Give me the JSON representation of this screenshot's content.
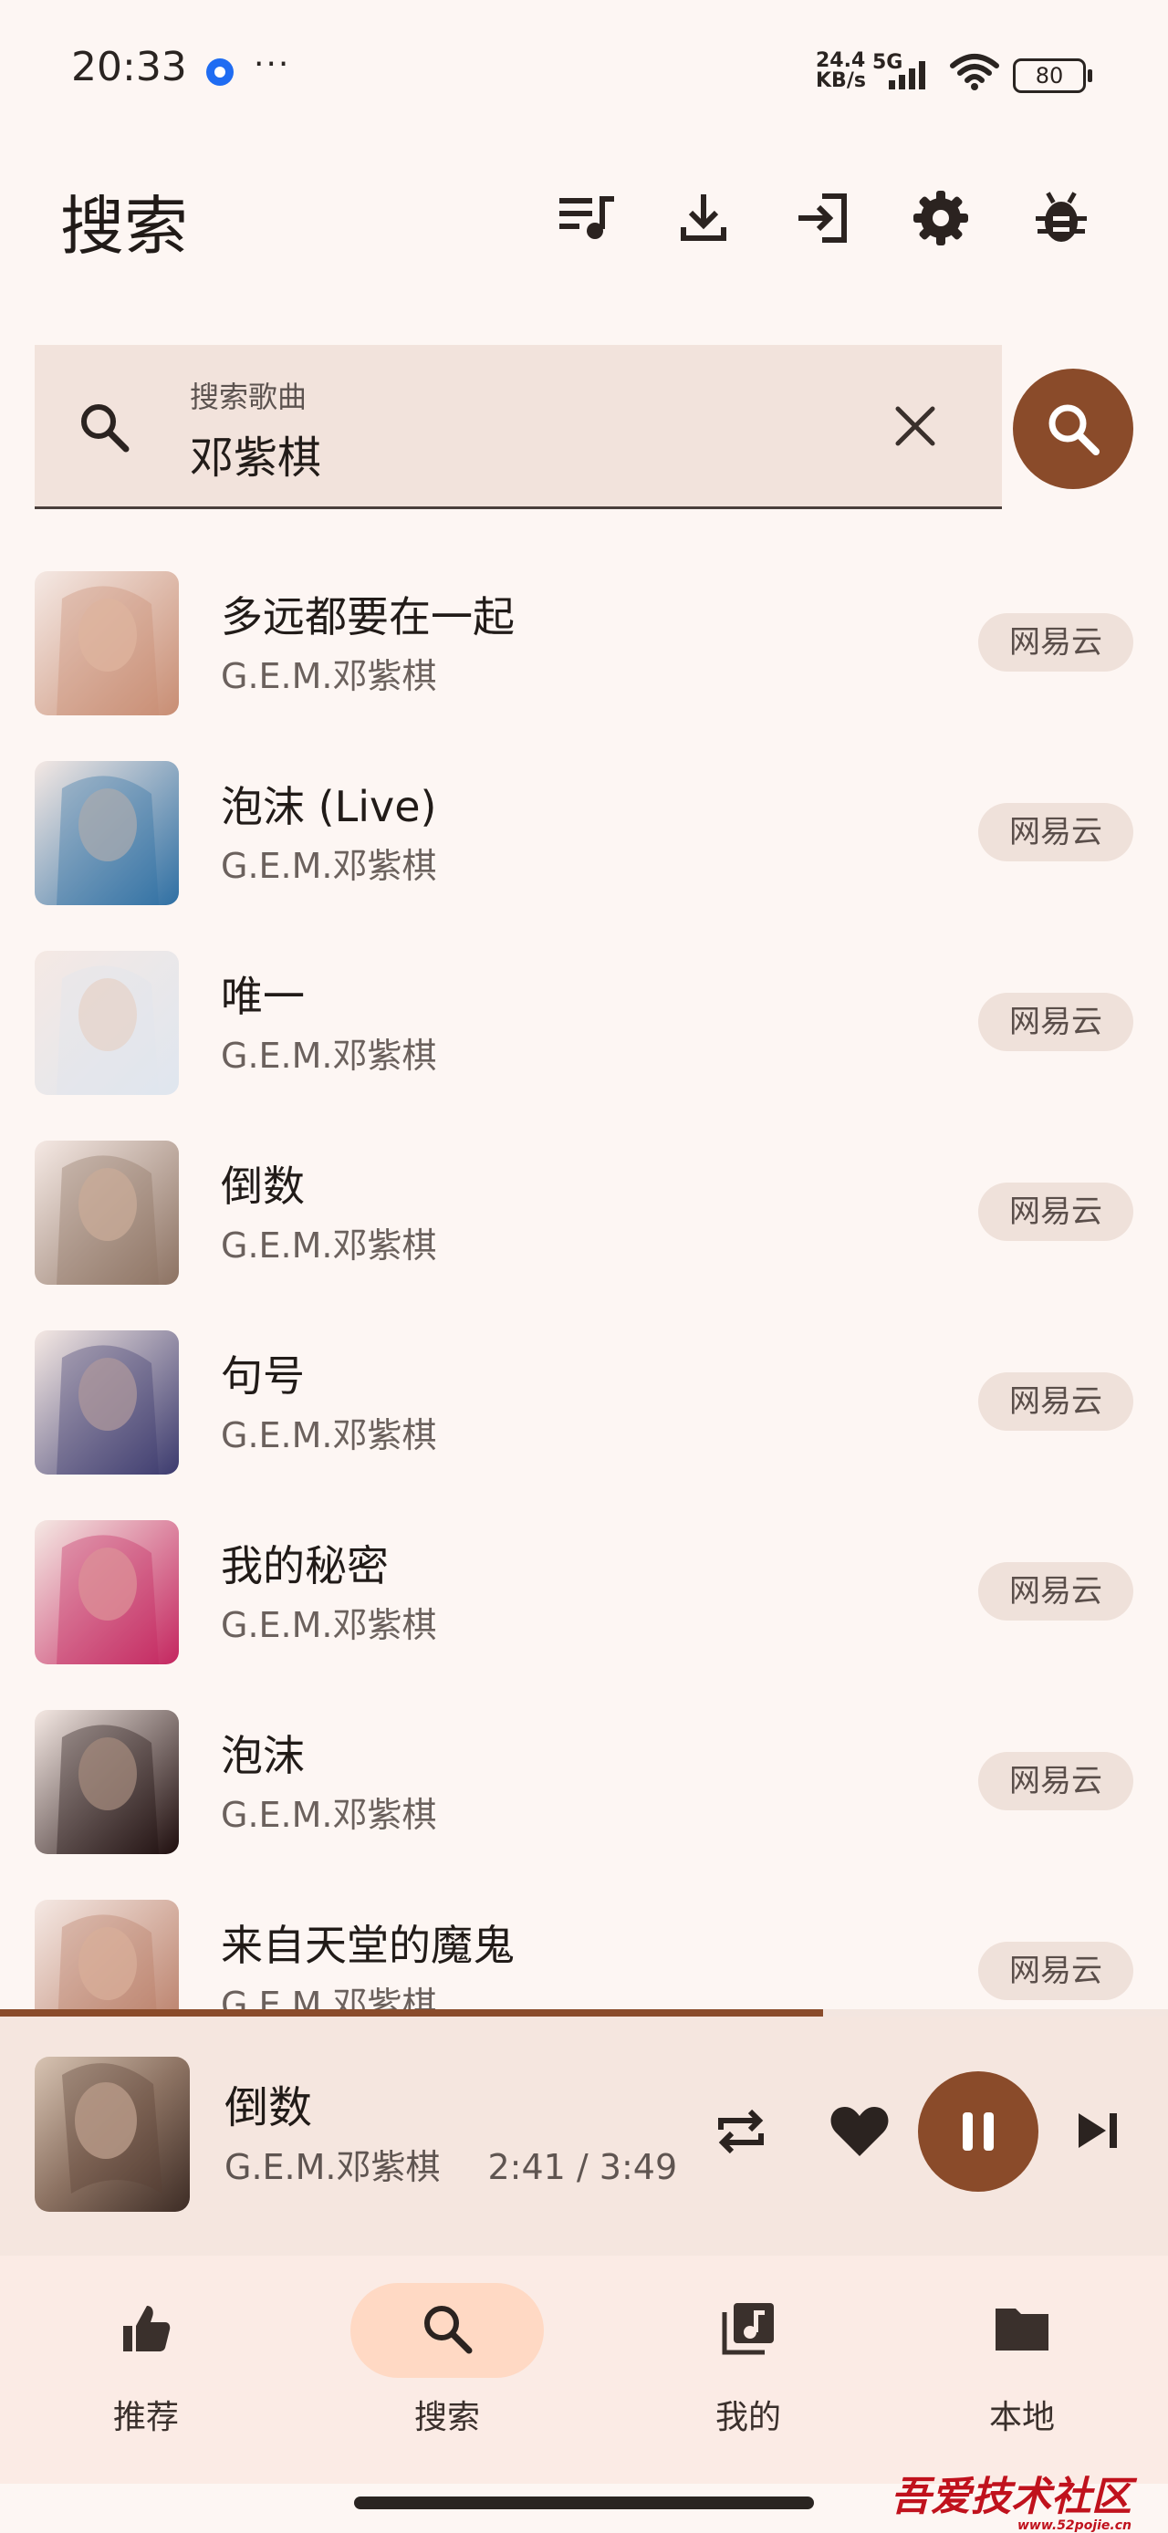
{
  "status_bar": {
    "time": "20:33",
    "more": "···",
    "speed_value": "24.4",
    "speed_unit": "KB/s",
    "network": "5G",
    "battery": "80"
  },
  "app_bar": {
    "title": "搜索",
    "actions": [
      "playlist-icon",
      "download-icon",
      "login-icon",
      "settings-icon",
      "bug-icon"
    ]
  },
  "search": {
    "label": "搜索歌曲",
    "value": "邓紫棋"
  },
  "results": [
    {
      "title": "多远都要在一起",
      "artist": "G.E.M.邓紫棋",
      "source": "网易云",
      "cover": "#c88d73"
    },
    {
      "title": "泡沫 (Live)",
      "artist": "G.E.M.邓紫棋",
      "source": "网易云",
      "cover": "#2e6fa3"
    },
    {
      "title": "唯一",
      "artist": "G.E.M.邓紫棋",
      "source": "网易云",
      "cover": "#dfe6ef"
    },
    {
      "title": "倒数",
      "artist": "G.E.M.邓紫棋",
      "source": "网易云",
      "cover": "#8c7262"
    },
    {
      "title": "句号",
      "artist": "G.E.M.邓紫棋",
      "source": "网易云",
      "cover": "#3b3a6e"
    },
    {
      "title": "我的秘密",
      "artist": "G.E.M.邓紫棋",
      "source": "网易云",
      "cover": "#c4265f"
    },
    {
      "title": "泡沫",
      "artist": "G.E.M.邓紫棋",
      "source": "网易云",
      "cover": "#1e0d0d"
    },
    {
      "title": "来自天堂的魔鬼",
      "artist": "G.E.M.邓紫棋",
      "source": "网易云",
      "cover": "#b77a63"
    }
  ],
  "player": {
    "title": "倒数",
    "artist": "G.E.M.邓紫棋",
    "elapsed": "2:41",
    "total": "3:49",
    "progress": 0.705
  },
  "nav": [
    {
      "label": "推荐",
      "icon": "thumb-up-icon",
      "active": false
    },
    {
      "label": "搜索",
      "icon": "search-icon",
      "active": true
    },
    {
      "label": "我的",
      "icon": "library-music-icon",
      "active": false
    },
    {
      "label": "本地",
      "icon": "folder-icon",
      "active": false
    }
  ],
  "watermark": {
    "text": "吾爱技术社区",
    "sub": "www.52pojie.cn"
  },
  "colors": {
    "accent": "#8a4b2a",
    "background": "#fdf6f3",
    "chip": "#efe1da",
    "nav_active": "#ffd9c4"
  }
}
